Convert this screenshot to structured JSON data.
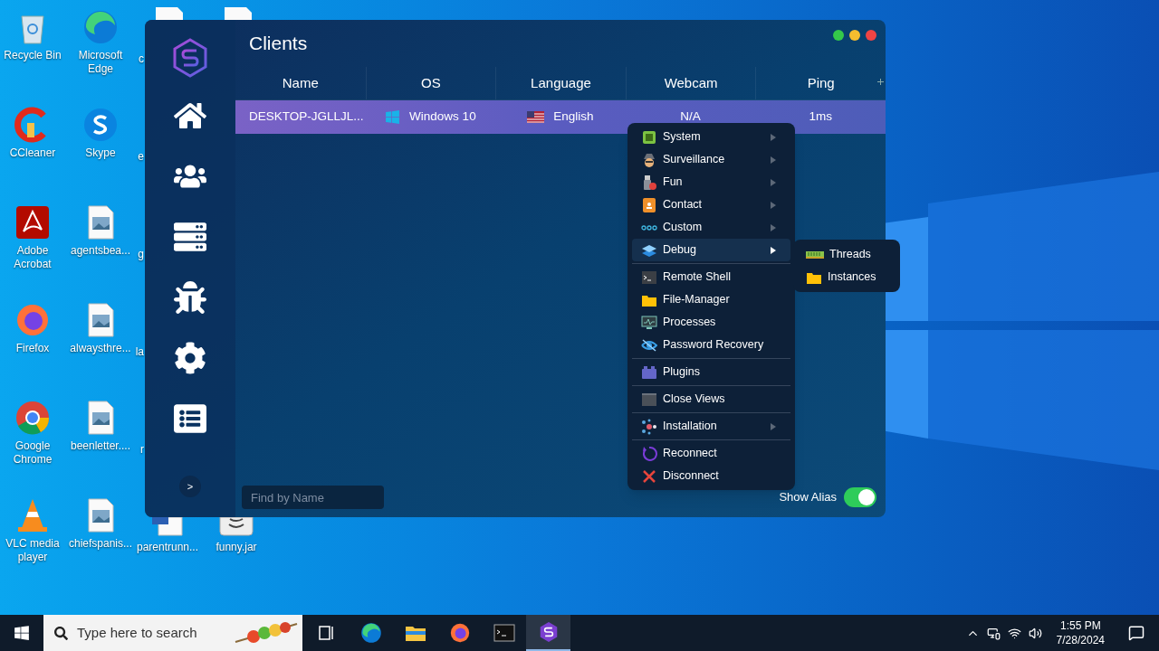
{
  "desktop": {
    "icons": [
      {
        "label": "Recycle Bin",
        "kind": "recycle"
      },
      {
        "label": "CCleaner",
        "kind": "ccleaner"
      },
      {
        "label": "Adobe Acrobat",
        "kind": "acrobat"
      },
      {
        "label": "Firefox",
        "kind": "firefox"
      },
      {
        "label": "Google Chrome",
        "kind": "chrome"
      },
      {
        "label": "VLC media player",
        "kind": "vlc"
      },
      {
        "label": "Microsoft Edge",
        "kind": "edge"
      },
      {
        "label": "Skype",
        "kind": "skype"
      },
      {
        "label": "agentsbea...",
        "kind": "image"
      },
      {
        "label": "alwaysthre...",
        "kind": "image"
      },
      {
        "label": "beenletter....",
        "kind": "image"
      },
      {
        "label": "chiefspanis...",
        "kind": "image"
      },
      {
        "label": "parentrunn...",
        "kind": "word"
      },
      {
        "label": "funny.jar",
        "kind": "jar"
      }
    ],
    "cut_labels": [
      "c",
      "e",
      "g",
      "la",
      "r"
    ]
  },
  "window": {
    "title": "Clients",
    "sidebar": [
      {
        "kind": "home"
      },
      {
        "kind": "users"
      },
      {
        "kind": "server"
      },
      {
        "kind": "bug"
      },
      {
        "kind": "settings"
      },
      {
        "kind": "list"
      }
    ],
    "expand": ">",
    "columns": [
      "Name",
      "OS",
      "Language",
      "Webcam",
      "Ping"
    ],
    "rows": [
      {
        "name": "DESKTOP-JGLLJL...",
        "os": "Windows 10",
        "language": "English",
        "webcam": "N/A",
        "ping": "1ms",
        "selected": true
      }
    ],
    "search": {
      "placeholder": "Find by Name"
    },
    "show_alias": {
      "label": "Show Alias",
      "on": true
    }
  },
  "context_menu": {
    "groups": [
      [
        {
          "label": "System",
          "kind": "chip",
          "submenu": true,
          "selected": false
        },
        {
          "label": "Surveillance",
          "kind": "spy",
          "submenu": true,
          "selected": false
        },
        {
          "label": "Fun",
          "kind": "usb",
          "submenu": true,
          "selected": false
        },
        {
          "label": "Contact",
          "kind": "contact",
          "submenu": true,
          "selected": false
        },
        {
          "label": "Custom",
          "kind": "dots",
          "submenu": true,
          "selected": false
        },
        {
          "label": "Debug",
          "kind": "layers",
          "submenu": true,
          "selected": true
        }
      ],
      [
        {
          "label": "Remote Shell",
          "kind": "terminal",
          "submenu": false,
          "selected": false
        },
        {
          "label": "File-Manager",
          "kind": "folder",
          "submenu": false,
          "selected": false
        },
        {
          "label": "Processes",
          "kind": "monitor",
          "submenu": false,
          "selected": false
        },
        {
          "label": "Password Recovery",
          "kind": "eye",
          "submenu": false,
          "selected": false
        }
      ],
      [
        {
          "label": "Plugins",
          "kind": "plugin",
          "submenu": false,
          "selected": false
        }
      ],
      [
        {
          "label": "Close Views",
          "kind": "window",
          "submenu": false,
          "selected": false
        }
      ],
      [
        {
          "label": "Installation",
          "kind": "network",
          "submenu": true,
          "selected": false
        }
      ],
      [
        {
          "label": "Reconnect",
          "kind": "reconnect",
          "submenu": false,
          "selected": false
        },
        {
          "label": "Disconnect",
          "kind": "cross",
          "submenu": false,
          "selected": false
        }
      ]
    ],
    "submenu": [
      {
        "label": "Threads",
        "kind": "ram"
      },
      {
        "label": "Instances",
        "kind": "folder"
      }
    ]
  },
  "taskbar": {
    "search": {
      "placeholder": "Type here to search"
    },
    "apps": [
      {
        "kind": "taskview",
        "selected": false
      },
      {
        "kind": "edge",
        "selected": false
      },
      {
        "kind": "explorer",
        "selected": false
      },
      {
        "kind": "firefox",
        "selected": false
      },
      {
        "kind": "terminal",
        "selected": false
      },
      {
        "kind": "logo",
        "selected": true
      }
    ],
    "time": "1:55 PM",
    "date": "7/28/2024"
  }
}
